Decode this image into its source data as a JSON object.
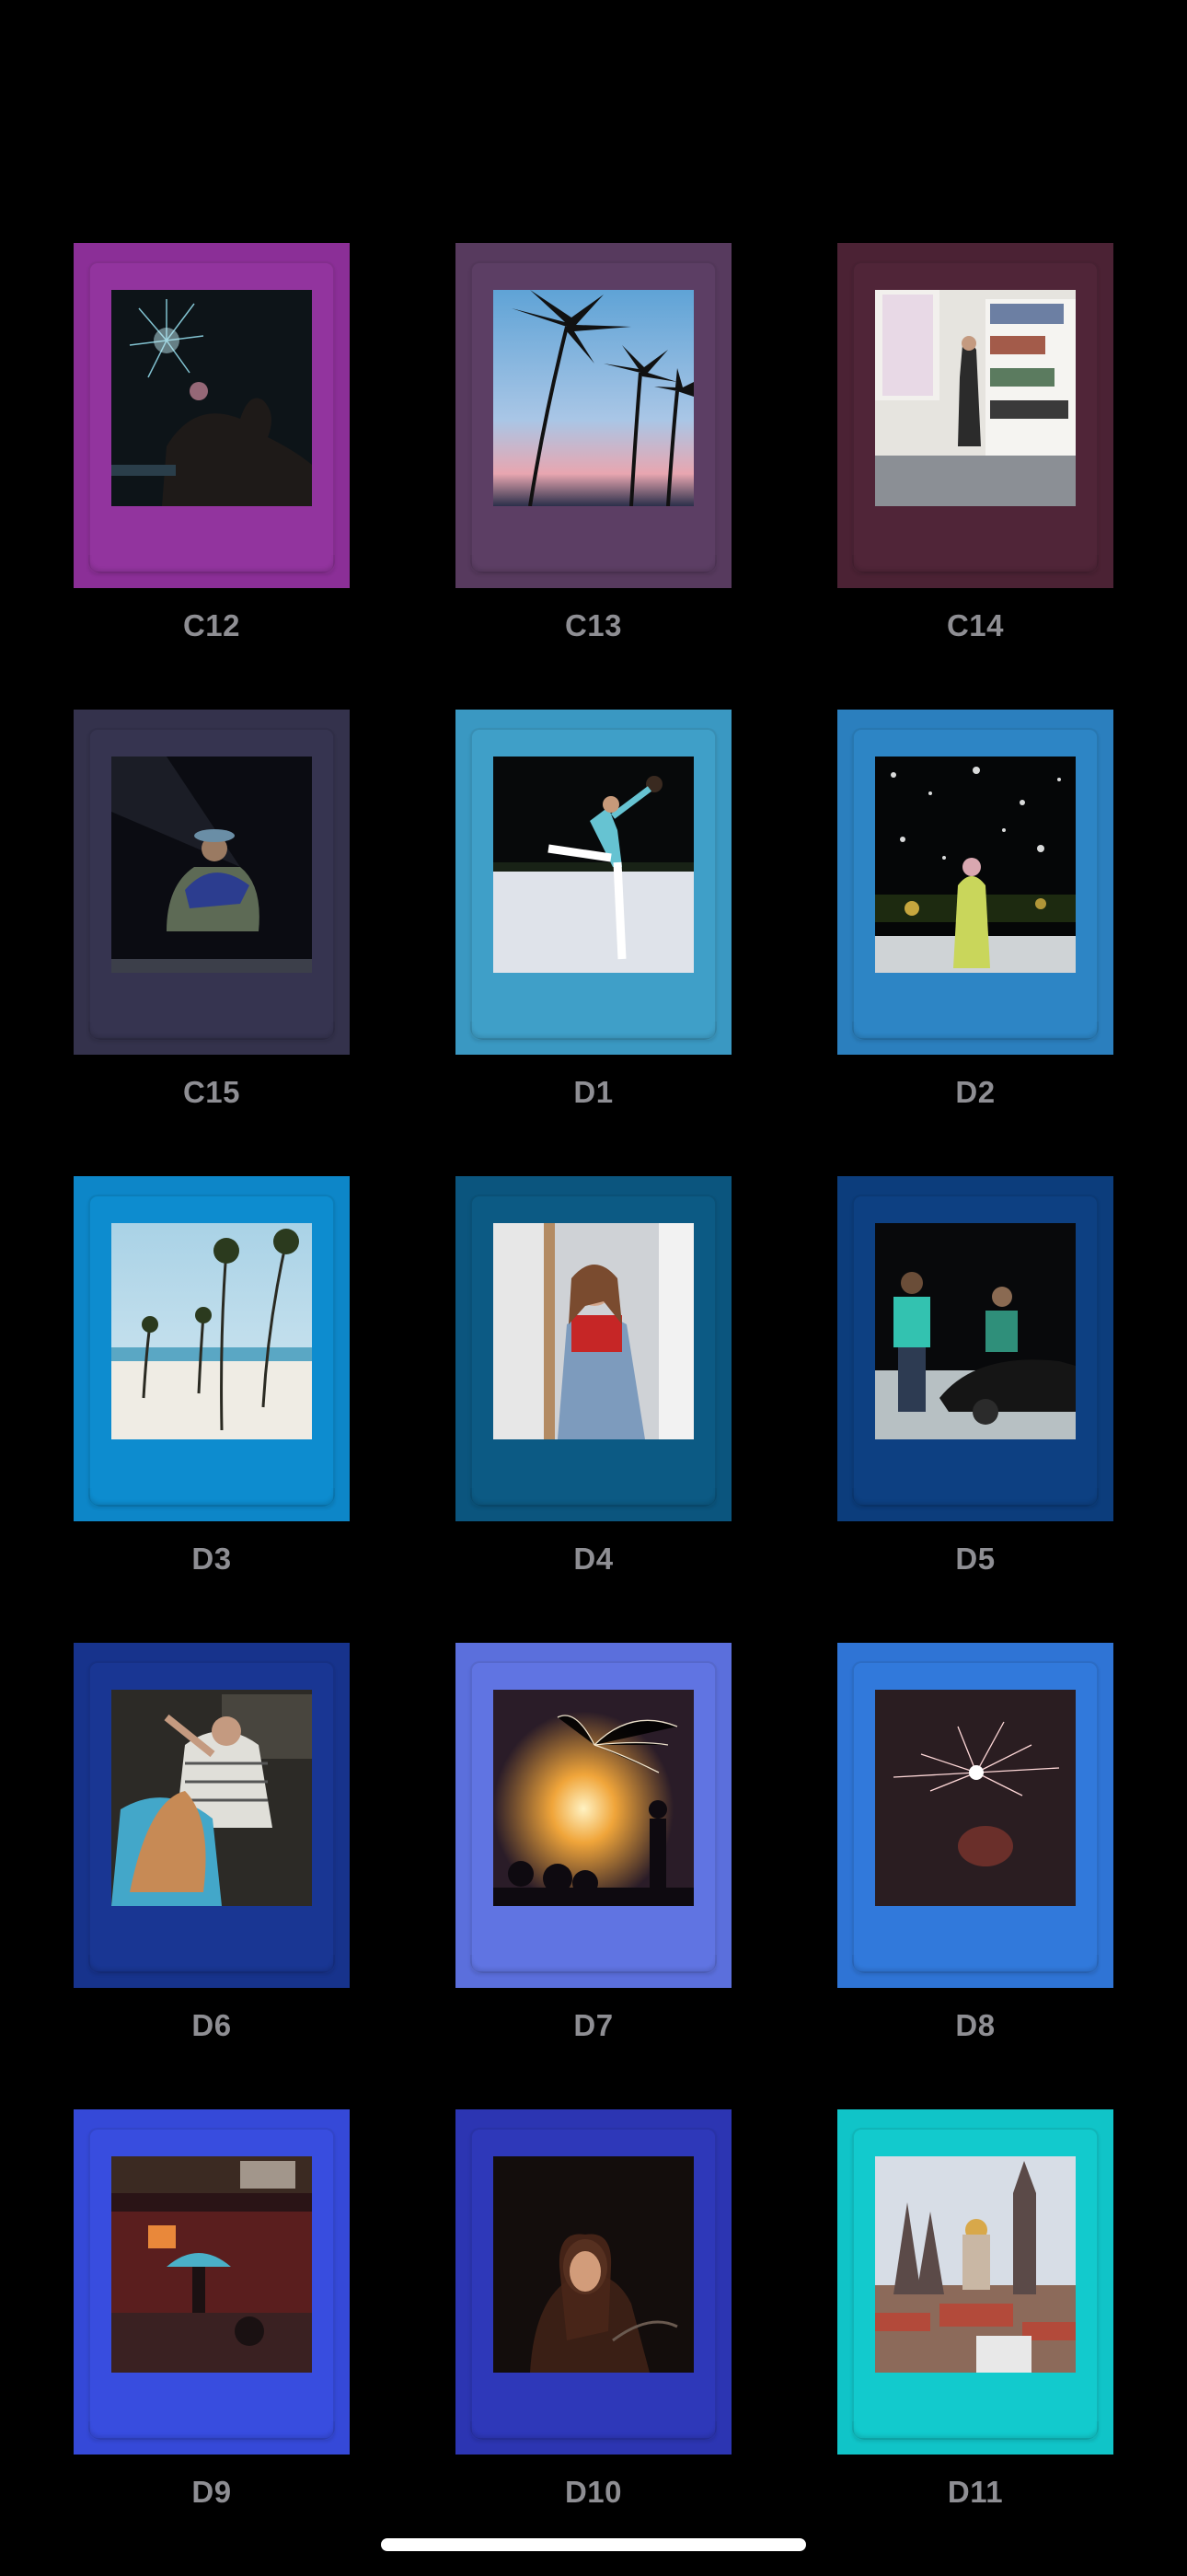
{
  "frames": [
    {
      "label": "C12",
      "color": "#8b2f97",
      "inner": "#92349e",
      "photo": "fireworks-night"
    },
    {
      "label": "C13",
      "color": "#573a5e",
      "inner": "#5c3e64",
      "photo": "palm-sunset"
    },
    {
      "label": "C14",
      "color": "#4b2234",
      "inner": "#502538",
      "photo": "bookshelf-room"
    },
    {
      "label": "C15",
      "color": "#34324c",
      "inner": "#363450",
      "photo": "crouching-man-night"
    },
    {
      "label": "D1",
      "color": "#3a98c2",
      "inner": "#3f9fc8",
      "photo": "snow-kick"
    },
    {
      "label": "D2",
      "color": "#2b7fbe",
      "inner": "#2d85c5",
      "photo": "snowfall-night"
    },
    {
      "label": "D3",
      "color": "#0d86c8",
      "inner": "#0d8ccf",
      "photo": "beach-palms"
    },
    {
      "label": "D4",
      "color": "#0b557e",
      "inner": "#0c5a84",
      "photo": "girl-overalls"
    },
    {
      "label": "D5",
      "color": "#0c3d7c",
      "inner": "#0d4082",
      "photo": "car-night"
    },
    {
      "label": "D6",
      "color": "#17338c",
      "inner": "#193693",
      "photo": "party-crowd"
    },
    {
      "label": "D7",
      "color": "#5b6fdc",
      "inner": "#6074e2",
      "photo": "bonfire-beach"
    },
    {
      "label": "D8",
      "color": "#2f74d5",
      "inner": "#3179db",
      "photo": "sparkler"
    },
    {
      "label": "D9",
      "color": "#3549d8",
      "inner": "#384ddf",
      "photo": "umbrella-street"
    },
    {
      "label": "D10",
      "color": "#2c35b2",
      "inner": "#2e38b9",
      "photo": "girl-dark"
    },
    {
      "label": "D11",
      "color": "#10c4c8",
      "inner": "#12cacd",
      "photo": "city-towers"
    }
  ]
}
